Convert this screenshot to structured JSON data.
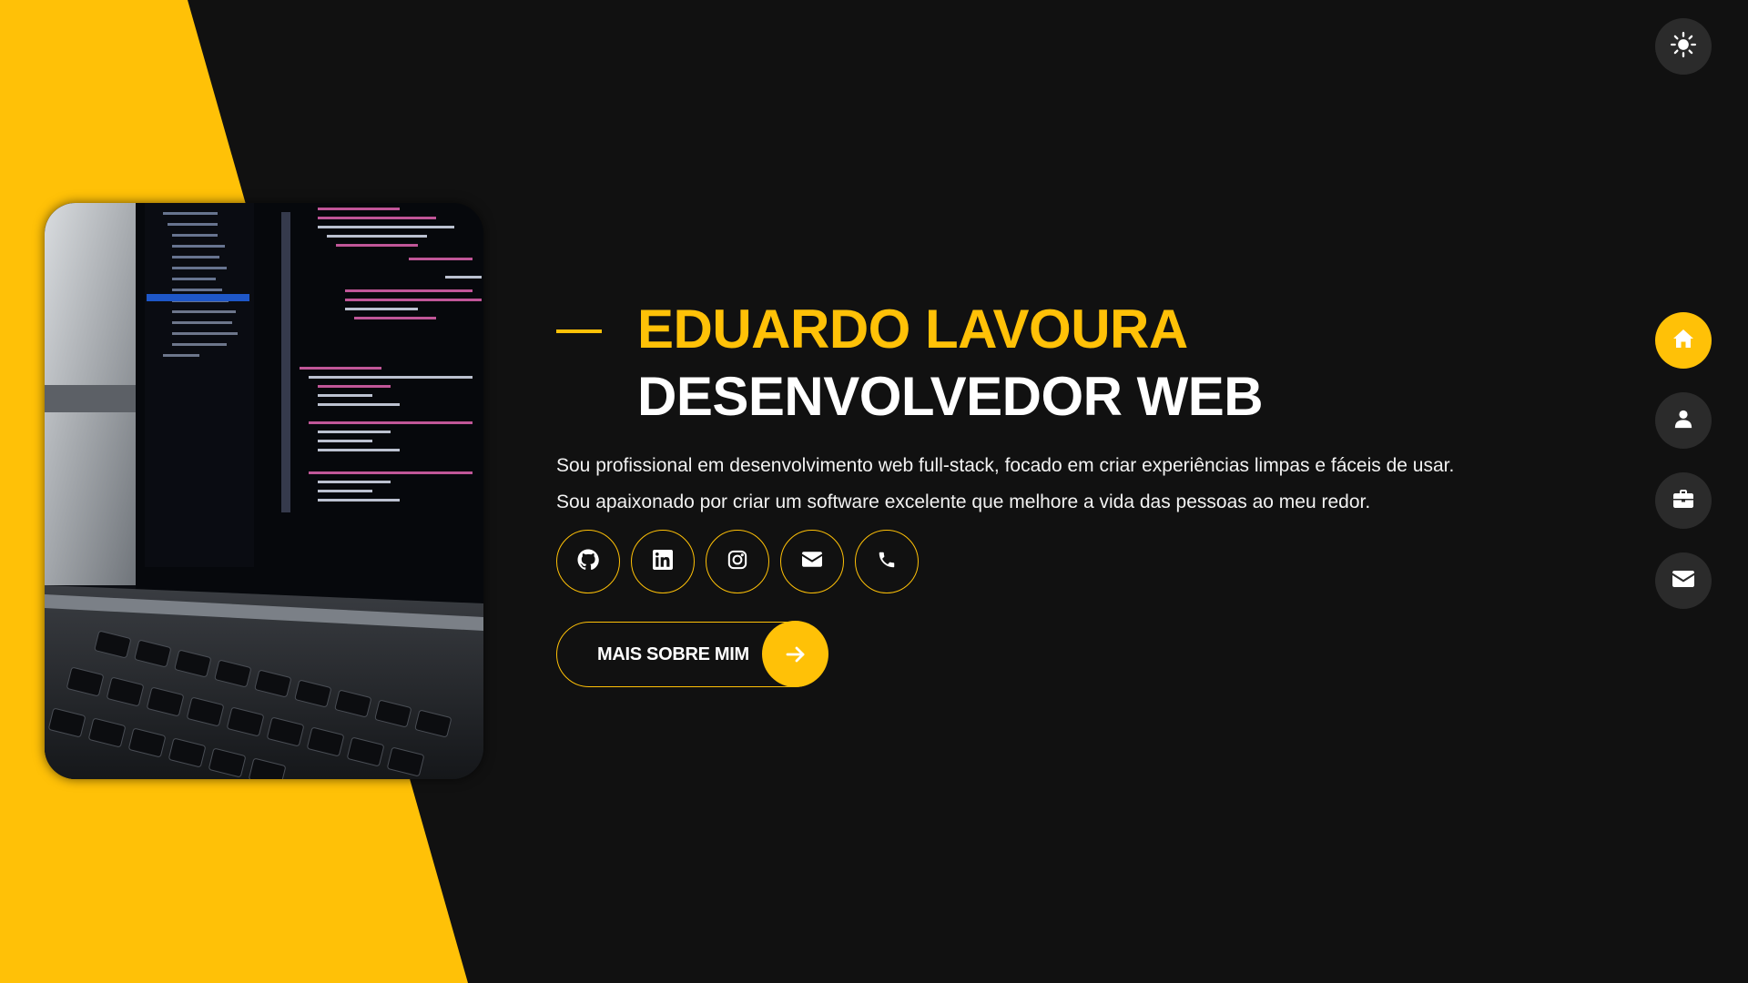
{
  "hero": {
    "name": "EDUARDO LAVOURA",
    "role": "DESENVOLVEDOR WEB",
    "description": [
      "Sou profissional em desenvolvimento web full-stack, focado em criar experiências limpas e fáceis de usar.",
      "Sou apaixonado por criar um software excelente que melhore a vida das pessoas ao meu redor."
    ],
    "cta_label": "MAIS SOBRE MIM"
  },
  "socials": [
    {
      "name": "github",
      "icon": "github-icon"
    },
    {
      "name": "linkedin",
      "icon": "linkedin-icon"
    },
    {
      "name": "instagram",
      "icon": "instagram-icon"
    },
    {
      "name": "email",
      "icon": "envelope-icon"
    },
    {
      "name": "phone",
      "icon": "phone-icon"
    }
  ],
  "nav": [
    {
      "name": "home",
      "icon": "home-icon",
      "active": true
    },
    {
      "name": "about",
      "icon": "user-icon",
      "active": false
    },
    {
      "name": "portfolio",
      "icon": "briefcase-icon",
      "active": false
    },
    {
      "name": "contact",
      "icon": "envelope-icon",
      "active": false
    }
  ],
  "theme_toggle": {
    "icon": "sun-icon"
  },
  "colors": {
    "accent": "#ffc107",
    "background": "#111111",
    "button_bg": "#2b2b2b",
    "text": "#ffffff"
  }
}
